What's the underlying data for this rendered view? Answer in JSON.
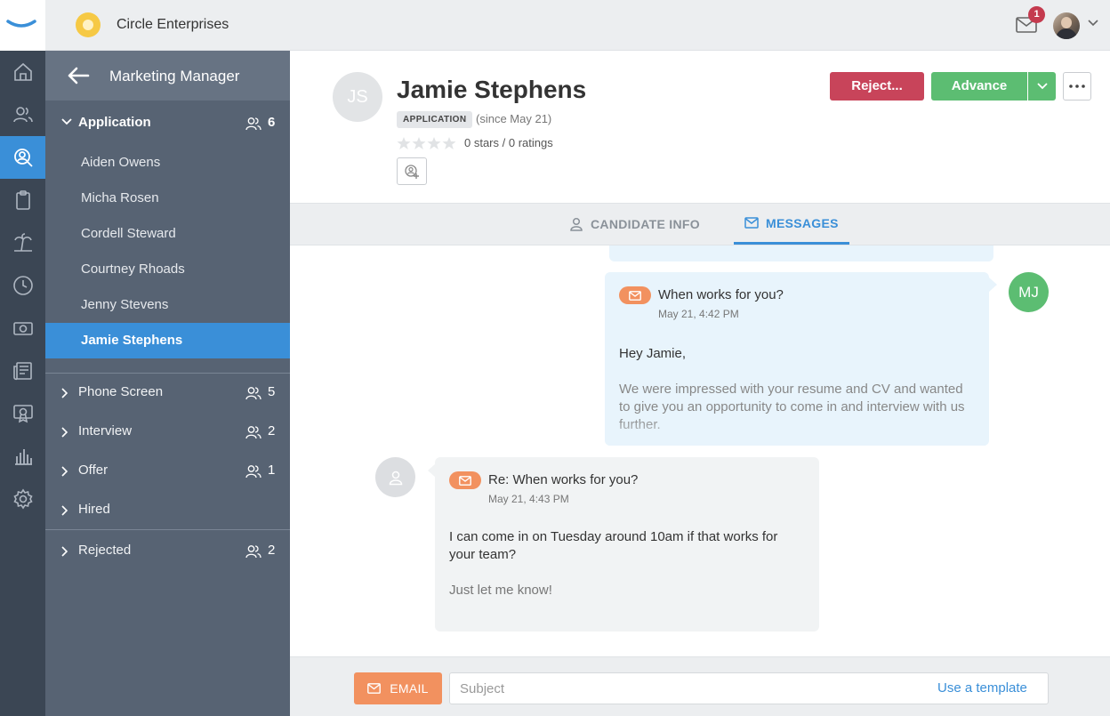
{
  "topbar": {
    "company_name": "Circle Enterprises",
    "mail_badge_count": "1"
  },
  "rail": {
    "items": [
      "home-icon",
      "people-icon",
      "candidate-search-icon",
      "clipboard-icon",
      "vacation-icon",
      "clock-icon",
      "money-icon",
      "news-icon",
      "certificate-icon",
      "reports-icon",
      "settings-icon"
    ],
    "active_index": 2
  },
  "stages": {
    "job_title": "Marketing Manager",
    "application": {
      "label": "Application",
      "count": "6"
    },
    "candidates": [
      "Aiden Owens",
      "Micha Rosen",
      "Cordell Steward",
      "Courtney Rhoads",
      "Jenny Stevens",
      "Jamie Stephens"
    ],
    "active_candidate": "Jamie Stephens",
    "phone_screen": {
      "label": "Phone Screen",
      "count": "5"
    },
    "interview": {
      "label": "Interview",
      "count": "2"
    },
    "offer": {
      "label": "Offer",
      "count": "1"
    },
    "hired": {
      "label": "Hired"
    },
    "rejected": {
      "label": "Rejected",
      "count": "2"
    }
  },
  "candidate": {
    "initials": "JS",
    "name": "Jamie Stephens",
    "stage_badge": "APPLICATION",
    "since": "(since May 21)",
    "stars": 0,
    "rating_text": "0 stars / 0 ratings"
  },
  "actions": {
    "reject_label": "Reject...",
    "advance_label": "Advance"
  },
  "tabs": {
    "info_label": "CANDIDATE INFO",
    "messages_label": "MESSAGES",
    "active": "messages"
  },
  "messages": {
    "outgoing": {
      "sender_initials": "MJ",
      "subject": "When works for you?",
      "time": "May 21, 4:42 PM",
      "greeting": "Hey Jamie,",
      "body": "We were impressed with your resume and CV and wanted to give you an opportunity to come in and interview with us further."
    },
    "incoming": {
      "subject": "Re: When works for you?",
      "time": "May 21, 4:43 PM",
      "body": "I can come in on Tuesday around 10am if that works for your team?",
      "closing": "Just let me know!"
    }
  },
  "compose": {
    "email_label": "EMAIL",
    "subject_placeholder": "Subject",
    "template_link": "Use a template"
  },
  "colors": {
    "accent": "#3a8fd8",
    "reject": "#c8445a",
    "advance": "#5cbd72",
    "email": "#f2915f",
    "rail": "#3b4654",
    "sidebar": "#576373"
  }
}
